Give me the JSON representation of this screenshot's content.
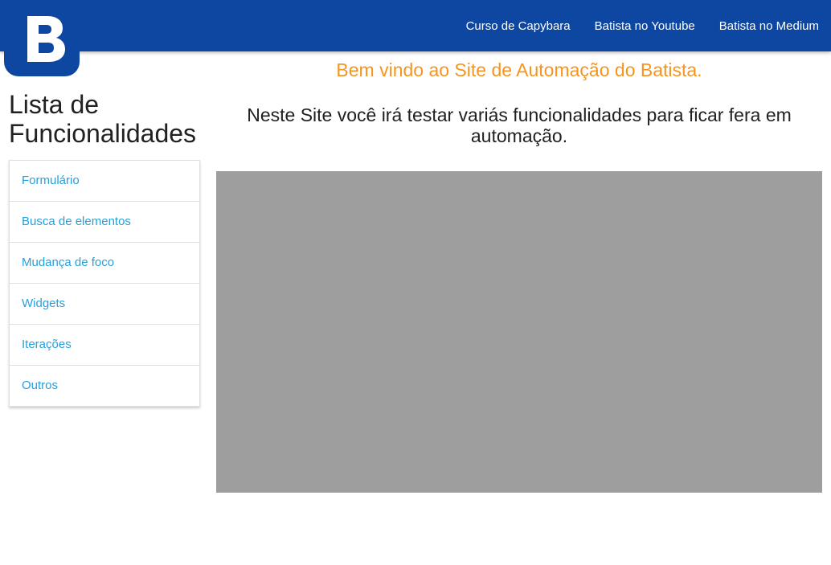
{
  "brand": {
    "logo_letter": "B",
    "logo_color": "#0d47a1",
    "logo_letter_color": "#3a5fe6"
  },
  "navbar": {
    "background": "#0d47a1",
    "links": [
      {
        "label": "Curso de Capybara"
      },
      {
        "label": "Batista no Youtube"
      },
      {
        "label": "Batista no Medium"
      }
    ]
  },
  "sidebar": {
    "title": "Lista de Funcionalidades",
    "items": [
      {
        "label": "Formulário"
      },
      {
        "label": "Busca de elementos"
      },
      {
        "label": "Mudança de foco"
      },
      {
        "label": "Widgets"
      },
      {
        "label": "Iterações"
      },
      {
        "label": "Outros"
      }
    ]
  },
  "main": {
    "welcome": "Bem vindo ao Site de Automação do Batista.",
    "description": "Neste Site você irá testar variás funcionalidades para ficar fera em automação.",
    "welcome_color": "#f7941d",
    "video_placeholder_color": "#9e9e9e"
  }
}
